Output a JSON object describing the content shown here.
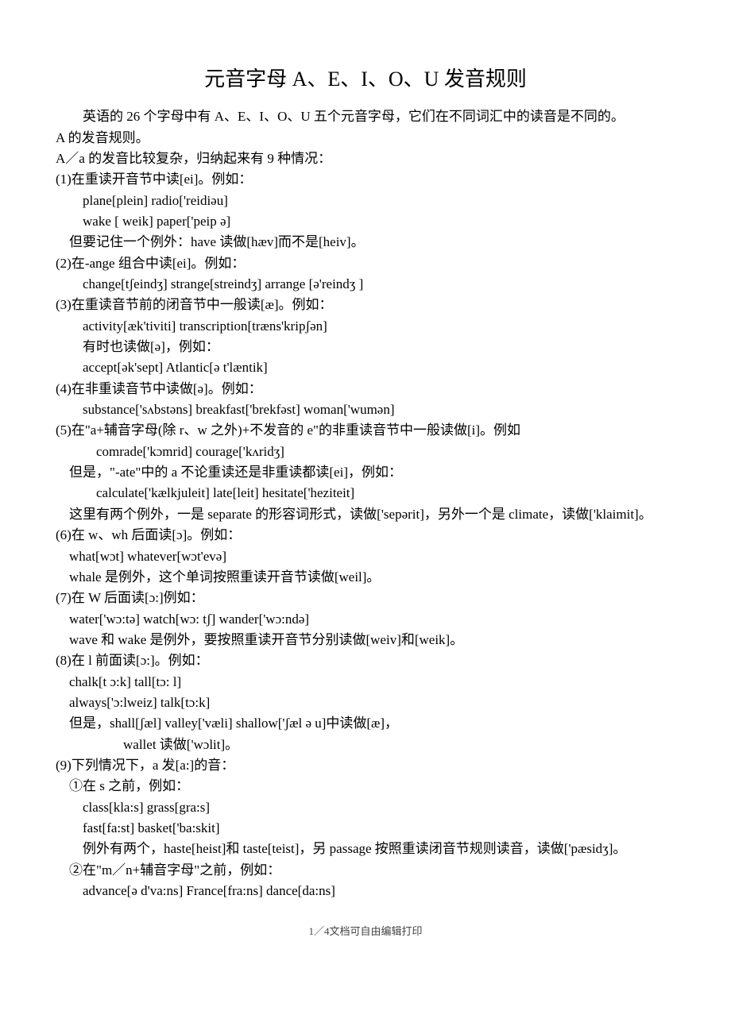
{
  "title": "元音字母 A、E、I、O、U 发音规则",
  "intro": "英语的 26 个字母中有 A、E、I、O、U 五个元音字母，它们在不同词汇中的读音是不同的。",
  "sectionA_title": "A 的发音规则。",
  "sectionA_sub": "A／a 的发音比较复杂，归纳起来有 9 种情况：",
  "rules": {
    "r1": "(1)在重读开音节中读[ei]。例如：",
    "r1_ex1": "plane[plein]        radio['reidiəu]",
    "r1_ex2": "wake [ weik]       paper['peip ə]",
    "r1_note": "但要记住一个例外：have 读做[hæv]而不是[heiv]。",
    "r2": "(2)在-ange 组合中读[ei]。例如：",
    "r2_ex1": "change[tʃeindʒ]     strange[streindʒ]    arrange [ə'reindʒ ]",
    "r3": "(3)在重读音节前的闭音节中一般读[æ]。例如：",
    "r3_ex1": "activity[æk'tiviti]    transcription[træns'kripʃən]",
    "r3_note1": "有时也读做[ə]，例如：",
    "r3_ex2": "accept[ək'sept]      Atlantic[ə t'læntik]",
    "r4": "(4)在非重读音节中读做[ə]。例如：",
    "r4_ex1": "substance['sʌbstəns]     breakfast['brekfəst]      woman['wumən]",
    "r5": "(5)在\"a+辅音字母(除 r、w 之外)+不发音的 e\"的非重读音节中一般读做[i]。例如",
    "r5_ex1": "comrade['kɔmrid]        courage['kʌridʒ]",
    "r5_note1": "但是，\"-ate\"中的 a 不论重读还是非重读都读[ei]，例如：",
    "r5_ex2": "calculate['kælkjuleit]       late[leit]       hesitate['heziteit]",
    "r5_note2": "这里有两个例外，一是 separate 的形容词形式，读做['sepərit]，另外一个是 climate，读做['klaimit]。",
    "r6": "(6)在 w、wh 后面读[ɔ]。例如：",
    "r6_ex1": "what[wɔt]     whatever[wɔt'evə]",
    "r6_note": "whale 是例外，这个单词按照重读开音节读做[weil]。",
    "r7": "(7)在 W 后面读[ɔ:]例如：",
    "r7_ex1": "water['wɔ:tə]       watch[wɔ: tʃ]     wander['wɔ:ndə]",
    "r7_note": "wave 和 wake 是例外，要按照重读开音节分别读做[weiv]和[weik]。",
    "r8": "(8)在 l 前面读[ɔ:]。例如：",
    "r8_ex1": "chalk[t ɔ:k]           tall[tɔ: l]",
    "r8_ex2": "always['ɔ:lweiz]     talk[tɔ:k]",
    "r8_note1": "但是，shall[ʃæl]     valley['væli]     shallow['ʃæl ə u]中读做[æ]，",
    "r8_note2": "wallet 读做['wɔlit]。",
    "r9": "(9)下列情况下，a 发[a:]的音：",
    "r9_a": "①在 s 之前，例如：",
    "r9_a_ex1": "class[kla:s]       grass[gra:s]",
    "r9_a_ex2": "fast[fa:st]         basket['ba:skit]",
    "r9_a_note": "例外有两个，haste[heist]和 taste[teist]，另 passage 按照重读闭音节规则读音，读做['pæsidʒ]。",
    "r9_b": "②在\"m／n+辅音字母\"之前，例如：",
    "r9_b_ex1": "advance[ə d'va:ns]       France[fra:ns]      dance[da:ns]"
  },
  "footer": "1／4文档可自由编辑打印"
}
